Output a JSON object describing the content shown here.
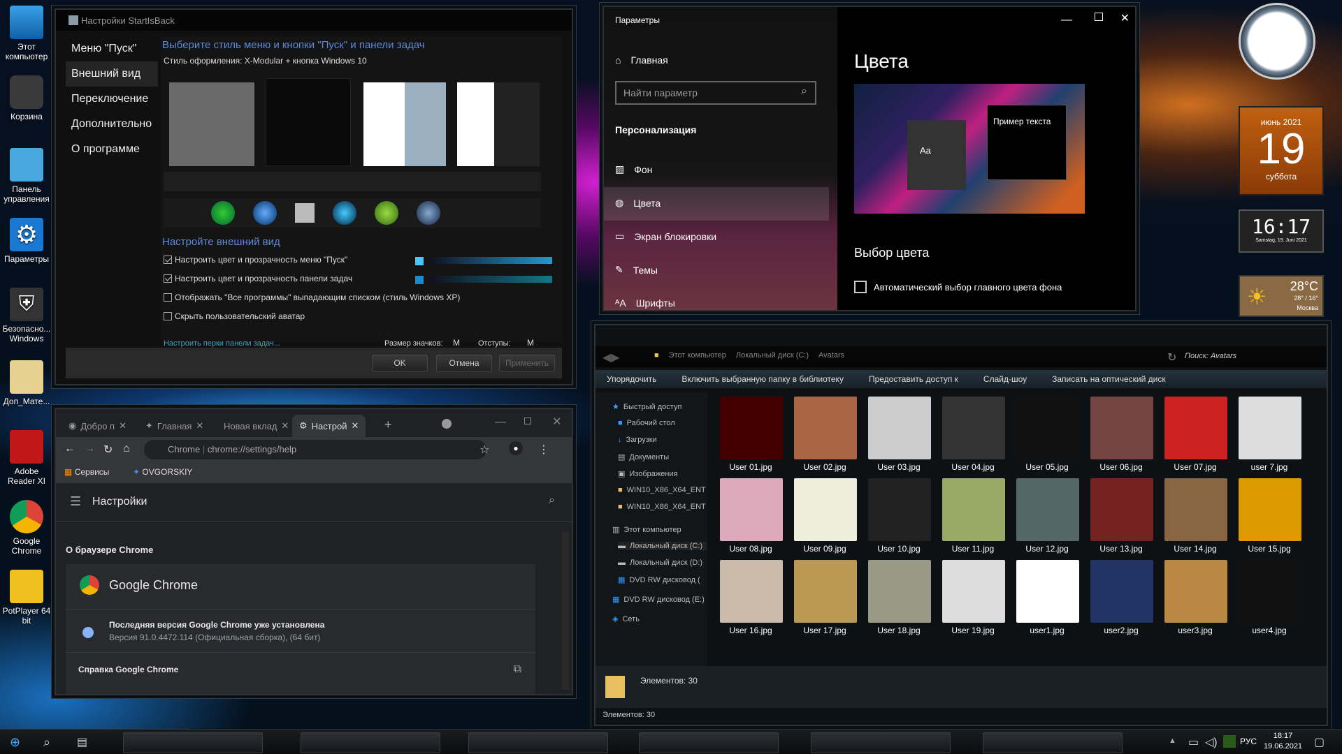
{
  "desktop_icons": [
    {
      "label": "Этот компьютер",
      "icon": "computer-icon"
    },
    {
      "label": "Корзина",
      "icon": "recycle-bin-icon"
    },
    {
      "label": "Панель управления",
      "icon": "control-panel-icon"
    },
    {
      "label": "Параметры",
      "icon": "settings-gear-icon"
    },
    {
      "label": "Безопасно... Windows",
      "icon": "shield-icon"
    },
    {
      "label": "Доп_Мате...",
      "icon": "folder-icon"
    },
    {
      "label": "Adobe Reader XI",
      "icon": "adobe-reader-icon"
    },
    {
      "label": "Google Chrome",
      "icon": "chrome-icon"
    },
    {
      "label": "PotPlayer 64 bit",
      "icon": "potplayer-icon"
    }
  ],
  "startisback": {
    "title": "Настройки StartIsBack",
    "nav": [
      "Меню \"Пуск\"",
      "Внешний вид",
      "Переключение",
      "Дополнительно",
      "О программе"
    ],
    "selected_nav": 1,
    "heading": "Выберите стиль меню и кнопки \"Пуск\" и панели задач",
    "style_label": "Стиль оформления:  X-Modular + кнопка Windows 10",
    "appearance_heading": "Настройте внешний вид",
    "options": [
      {
        "label": "Настроить цвет и прозрачность меню \"Пуск\"",
        "checked": true
      },
      {
        "label": "Настроить цвет и прозрачность панели задач",
        "checked": true
      },
      {
        "label": "Отображать \"Все программы\" выпадающим списком (стиль Windows XP)",
        "checked": false
      },
      {
        "label": "Скрыть пользовательский аватар",
        "checked": false
      }
    ],
    "colors": {
      "menu": "#4fc3f7",
      "taskbar": "#1e88c8"
    },
    "perks_link": "Настроить перки панели задач...",
    "icon_size_label": "Размер значков:",
    "icon_size_value": "M",
    "padding_label": "Отступы:",
    "padding_value": "M",
    "ok": "OK",
    "cancel": "Отмена",
    "apply": "Применить"
  },
  "settings": {
    "title": "Параметры",
    "home": "Главная",
    "search_placeholder": "Найти параметр",
    "section": "Персонализация",
    "items": [
      "Фон",
      "Цвета",
      "Экран блокировки",
      "Темы",
      "Шрифты"
    ],
    "selected": 1,
    "page_title": "Цвета",
    "preview_text": "Пример текста",
    "preview_aa": "Aa",
    "choose_color": "Выбор цвета",
    "auto_color": "Автоматический выбор главного цвета фона"
  },
  "widgets": {
    "calendar": {
      "month": "июнь 2021",
      "day": "19",
      "weekday": "суббота"
    },
    "clock_digital": "16:17",
    "clock_sub": "Samstag, 19. Juni 2021",
    "weather": {
      "temp": "28°C",
      "range": "28° / 16°",
      "city": "Москва"
    }
  },
  "chrome": {
    "tabs": [
      "Добро п",
      "Главная",
      "Новая вклад",
      "Настрой"
    ],
    "active_tab": 3,
    "site_label": "Chrome",
    "url": "chrome://settings/help",
    "bookmarks": [
      "Сервисы",
      "OVGORSKIY"
    ],
    "page_header": "Настройки",
    "section": "О браузере Chrome",
    "product": "Google Chrome",
    "status": "Последняя версия Google Chrome уже установлена",
    "version": "Версия 91.0.4472.114 (Официальная сборка), (64 бит)",
    "help": "Справка Google Chrome"
  },
  "explorer": {
    "breadcrumb": [
      "Этот компьютер",
      "Локальный диск (C:)",
      "Avatars"
    ],
    "search_placeholder": "Поиск: Avatars",
    "toolbar": [
      "Упорядочить",
      "Включить выбранную папку в библиотеку",
      "Предоставить доступ к",
      "Слайд-шоу",
      "Записать на оптический диск"
    ],
    "nav": [
      {
        "label": "Быстрый доступ",
        "level": 0
      },
      {
        "label": "Рабочий стол",
        "level": 1,
        "pinned": true
      },
      {
        "label": "Загрузки",
        "level": 1,
        "pinned": true
      },
      {
        "label": "Документы",
        "level": 1,
        "pinned": true
      },
      {
        "label": "Изображения",
        "level": 1,
        "pinned": true
      },
      {
        "label": "WIN10_X86_X64_ENT",
        "level": 1
      },
      {
        "label": "WIN10_X86_X64_ENT",
        "level": 1
      },
      {
        "label": "Этот компьютер",
        "level": 0
      },
      {
        "label": "Локальный диск (C:)",
        "level": 1,
        "selected": true
      },
      {
        "label": "Локальный диск (D:)",
        "level": 1
      },
      {
        "label": "DVD RW дисковод (",
        "level": 1
      },
      {
        "label": "DVD RW дисковод (E:)",
        "level": 0
      },
      {
        "label": "Сеть",
        "level": 0
      }
    ],
    "files": [
      "User 01.jpg",
      "User 02.jpg",
      "User 03.jpg",
      "User 04.jpg",
      "User 05.jpg",
      "User 06.jpg",
      "User 07.jpg",
      "user 7.jpg",
      "User 08.jpg",
      "User 09.jpg",
      "User 10.jpg",
      "User 11.jpg",
      "User 12.jpg",
      "User 13.jpg",
      "User 14.jpg",
      "User 15.jpg",
      "User 16.jpg",
      "User 17.jpg",
      "User 18.jpg",
      "User 19.jpg",
      "user1.jpg",
      "user2.jpg",
      "user3.jpg",
      "user4.jpg"
    ],
    "details": "Элементов: 30",
    "status": "Элементов: 30"
  },
  "tray": {
    "lang": "РУС",
    "time": "18:17",
    "date": "19.06.2021"
  }
}
